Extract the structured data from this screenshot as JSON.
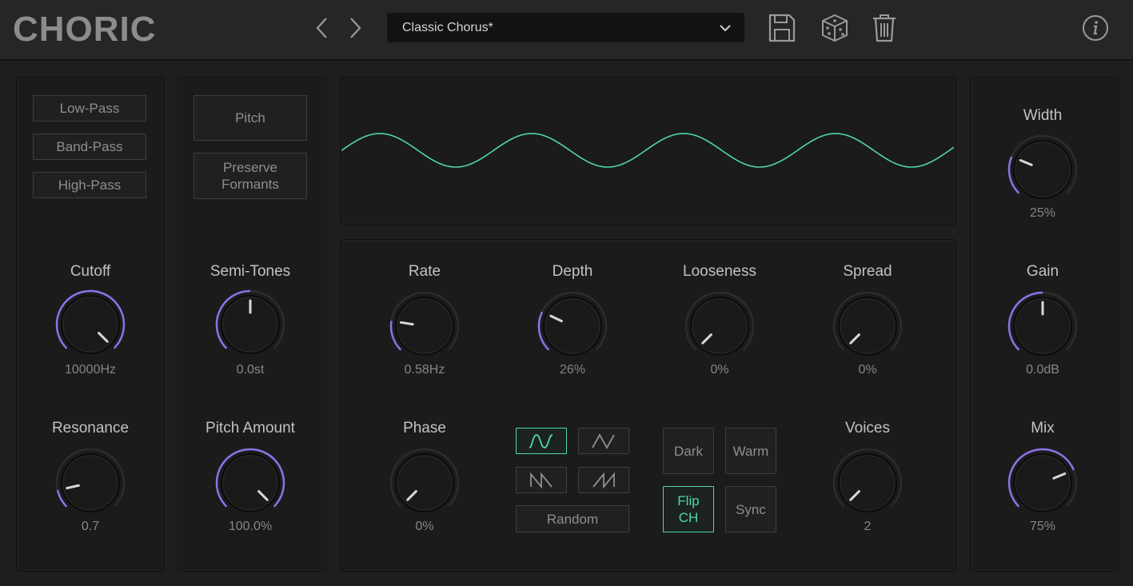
{
  "app": {
    "logo": "CHORIC"
  },
  "header": {
    "preset_name": "Classic Chorus*",
    "icons": [
      "chevron-left-icon",
      "chevron-right-icon",
      "chevron-down-icon",
      "save-icon",
      "dice-icon",
      "trash-icon",
      "info-icon"
    ]
  },
  "filter": {
    "types": [
      "Low-Pass",
      "Band-Pass",
      "High-Pass"
    ],
    "cutoff": {
      "label": "Cutoff",
      "value": "10000Hz",
      "level": 1.0
    },
    "resonance": {
      "label": "Resonance",
      "value": "0.7",
      "level": 0.12
    }
  },
  "pitch": {
    "pitch_btn": "Pitch",
    "preserve_btn": "Preserve Formants",
    "semitones": {
      "label": "Semi-Tones",
      "value": "0.0st",
      "level": 0.5
    },
    "pitch_amount": {
      "label": "Pitch Amount",
      "value": "100.0%",
      "level": 1.0
    }
  },
  "lfo": {
    "rate": {
      "label": "Rate",
      "value": "0.58Hz",
      "level": 0.2
    },
    "depth": {
      "label": "Depth",
      "value": "26%",
      "level": 0.26
    },
    "looseness": {
      "label": "Looseness",
      "value": "0%",
      "level": 0
    },
    "spread": {
      "label": "Spread",
      "value": "0%",
      "level": 0
    },
    "phase": {
      "label": "Phase",
      "value": "0%",
      "level": 0
    },
    "voices": {
      "label": "Voices",
      "value": "2",
      "level": 0
    },
    "random_btn": "Random",
    "dark_btn": "Dark",
    "warm_btn": "Warm",
    "flip_btn": "Flip CH",
    "sync_btn": "Sync",
    "waveshape_selected": "sine"
  },
  "output": {
    "width": {
      "label": "Width",
      "value": "25%",
      "level": 0.25
    },
    "gain": {
      "label": "Gain",
      "value": "0.0dB",
      "level": 0.5
    },
    "mix": {
      "label": "Mix",
      "value": "75%",
      "level": 0.75
    }
  },
  "colors": {
    "accent": "#4fd6b0",
    "knob_arc": "#8d72e8",
    "background": "#1e1e1e"
  }
}
